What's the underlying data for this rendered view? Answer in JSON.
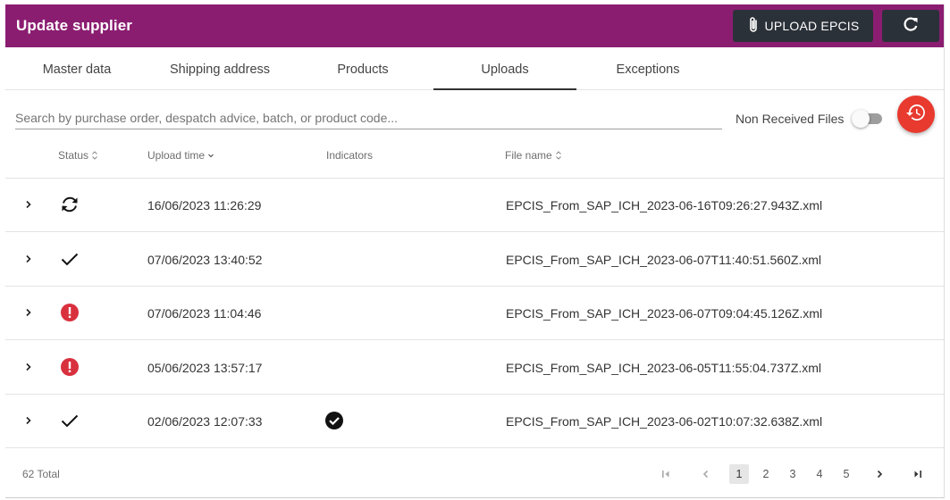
{
  "header": {
    "title": "Update supplier",
    "upload_label": "UPLOAD EPCIS",
    "background": "#8b1d71",
    "button_color": "#2b3138"
  },
  "tabs": [
    {
      "label": "Master data",
      "active": false
    },
    {
      "label": "Shipping address",
      "active": false
    },
    {
      "label": "Products",
      "active": false
    },
    {
      "label": "Uploads",
      "active": true
    },
    {
      "label": "Exceptions",
      "active": false
    }
  ],
  "search": {
    "placeholder": "Search by purchase order, despatch advice, batch, or product code...",
    "value": ""
  },
  "non_received_files": {
    "label": "Non Received Files",
    "enabled": false
  },
  "history_button": {
    "icon": "history-icon",
    "color": "#e83a2f"
  },
  "table": {
    "columns": [
      {
        "label": "Status",
        "sort": "unsorted"
      },
      {
        "label": "Upload time",
        "sort": "descending"
      },
      {
        "label": "Indicators",
        "sort": "none"
      },
      {
        "label": "File name",
        "sort": "unsorted"
      }
    ],
    "rows": [
      {
        "status": "processing",
        "time": "16/06/2023 11:26:29",
        "indicator": "",
        "file": "EPCIS_From_SAP_ICH_2023-06-16T09:26:27.943Z.xml"
      },
      {
        "status": "success",
        "time": "07/06/2023 13:40:52",
        "indicator": "",
        "file": "EPCIS_From_SAP_ICH_2023-06-07T11:40:51.560Z.xml"
      },
      {
        "status": "error",
        "time": "07/06/2023 11:04:46",
        "indicator": "",
        "file": "EPCIS_From_SAP_ICH_2023-06-07T09:04:45.126Z.xml"
      },
      {
        "status": "error",
        "time": "05/06/2023 13:57:17",
        "indicator": "",
        "file": "EPCIS_From_SAP_ICH_2023-06-05T11:55:04.737Z.xml"
      },
      {
        "status": "success",
        "time": "02/06/2023 12:07:33",
        "indicator": "check-circle",
        "file": "EPCIS_From_SAP_ICH_2023-06-02T10:07:32.638Z.xml"
      }
    ]
  },
  "footer": {
    "total": "62 Total",
    "pages": [
      "1",
      "2",
      "3",
      "4",
      "5"
    ],
    "current_page": "1"
  },
  "colors": {
    "error": "#d9303e",
    "text": "#333333"
  }
}
